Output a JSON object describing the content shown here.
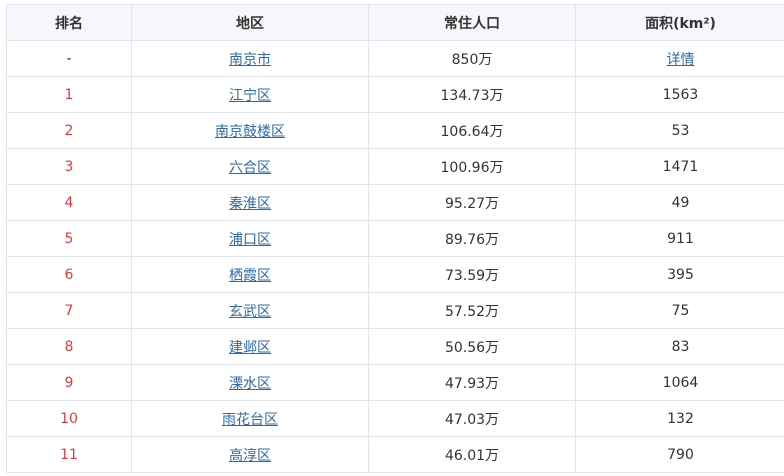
{
  "table": {
    "headers": [
      "排名",
      "地区",
      "常住人口",
      "面积(km²)"
    ],
    "rows": [
      {
        "rank": "-",
        "district": "南京市",
        "population": "850万",
        "area": "详情",
        "area_is_link": true
      },
      {
        "rank": "1",
        "district": "江宁区",
        "population": "134.73万",
        "area": "1563"
      },
      {
        "rank": "2",
        "district": "南京鼓楼区",
        "population": "106.64万",
        "area": "53"
      },
      {
        "rank": "3",
        "district": "六合区",
        "population": "100.96万",
        "area": "1471"
      },
      {
        "rank": "4",
        "district": "秦淮区",
        "population": "95.27万",
        "area": "49"
      },
      {
        "rank": "5",
        "district": "浦口区",
        "population": "89.76万",
        "area": "911"
      },
      {
        "rank": "6",
        "district": "栖霞区",
        "population": "73.59万",
        "area": "395"
      },
      {
        "rank": "7",
        "district": "玄武区",
        "population": "57.52万",
        "area": "75"
      },
      {
        "rank": "8",
        "district": "建邺区",
        "population": "50.56万",
        "area": "83"
      },
      {
        "rank": "9",
        "district": "溧水区",
        "population": "47.93万",
        "area": "1064"
      },
      {
        "rank": "10",
        "district": "雨花台区",
        "population": "47.03万",
        "area": "132"
      },
      {
        "rank": "11",
        "district": "高淳区",
        "population": "46.01万",
        "area": "790"
      }
    ]
  },
  "colors": {
    "rank_red": "#e4393c",
    "link_blue": "#2d6aa8",
    "header_bg": "#f5f7fa",
    "border": "#e1e6ee",
    "text": "#333333"
  }
}
